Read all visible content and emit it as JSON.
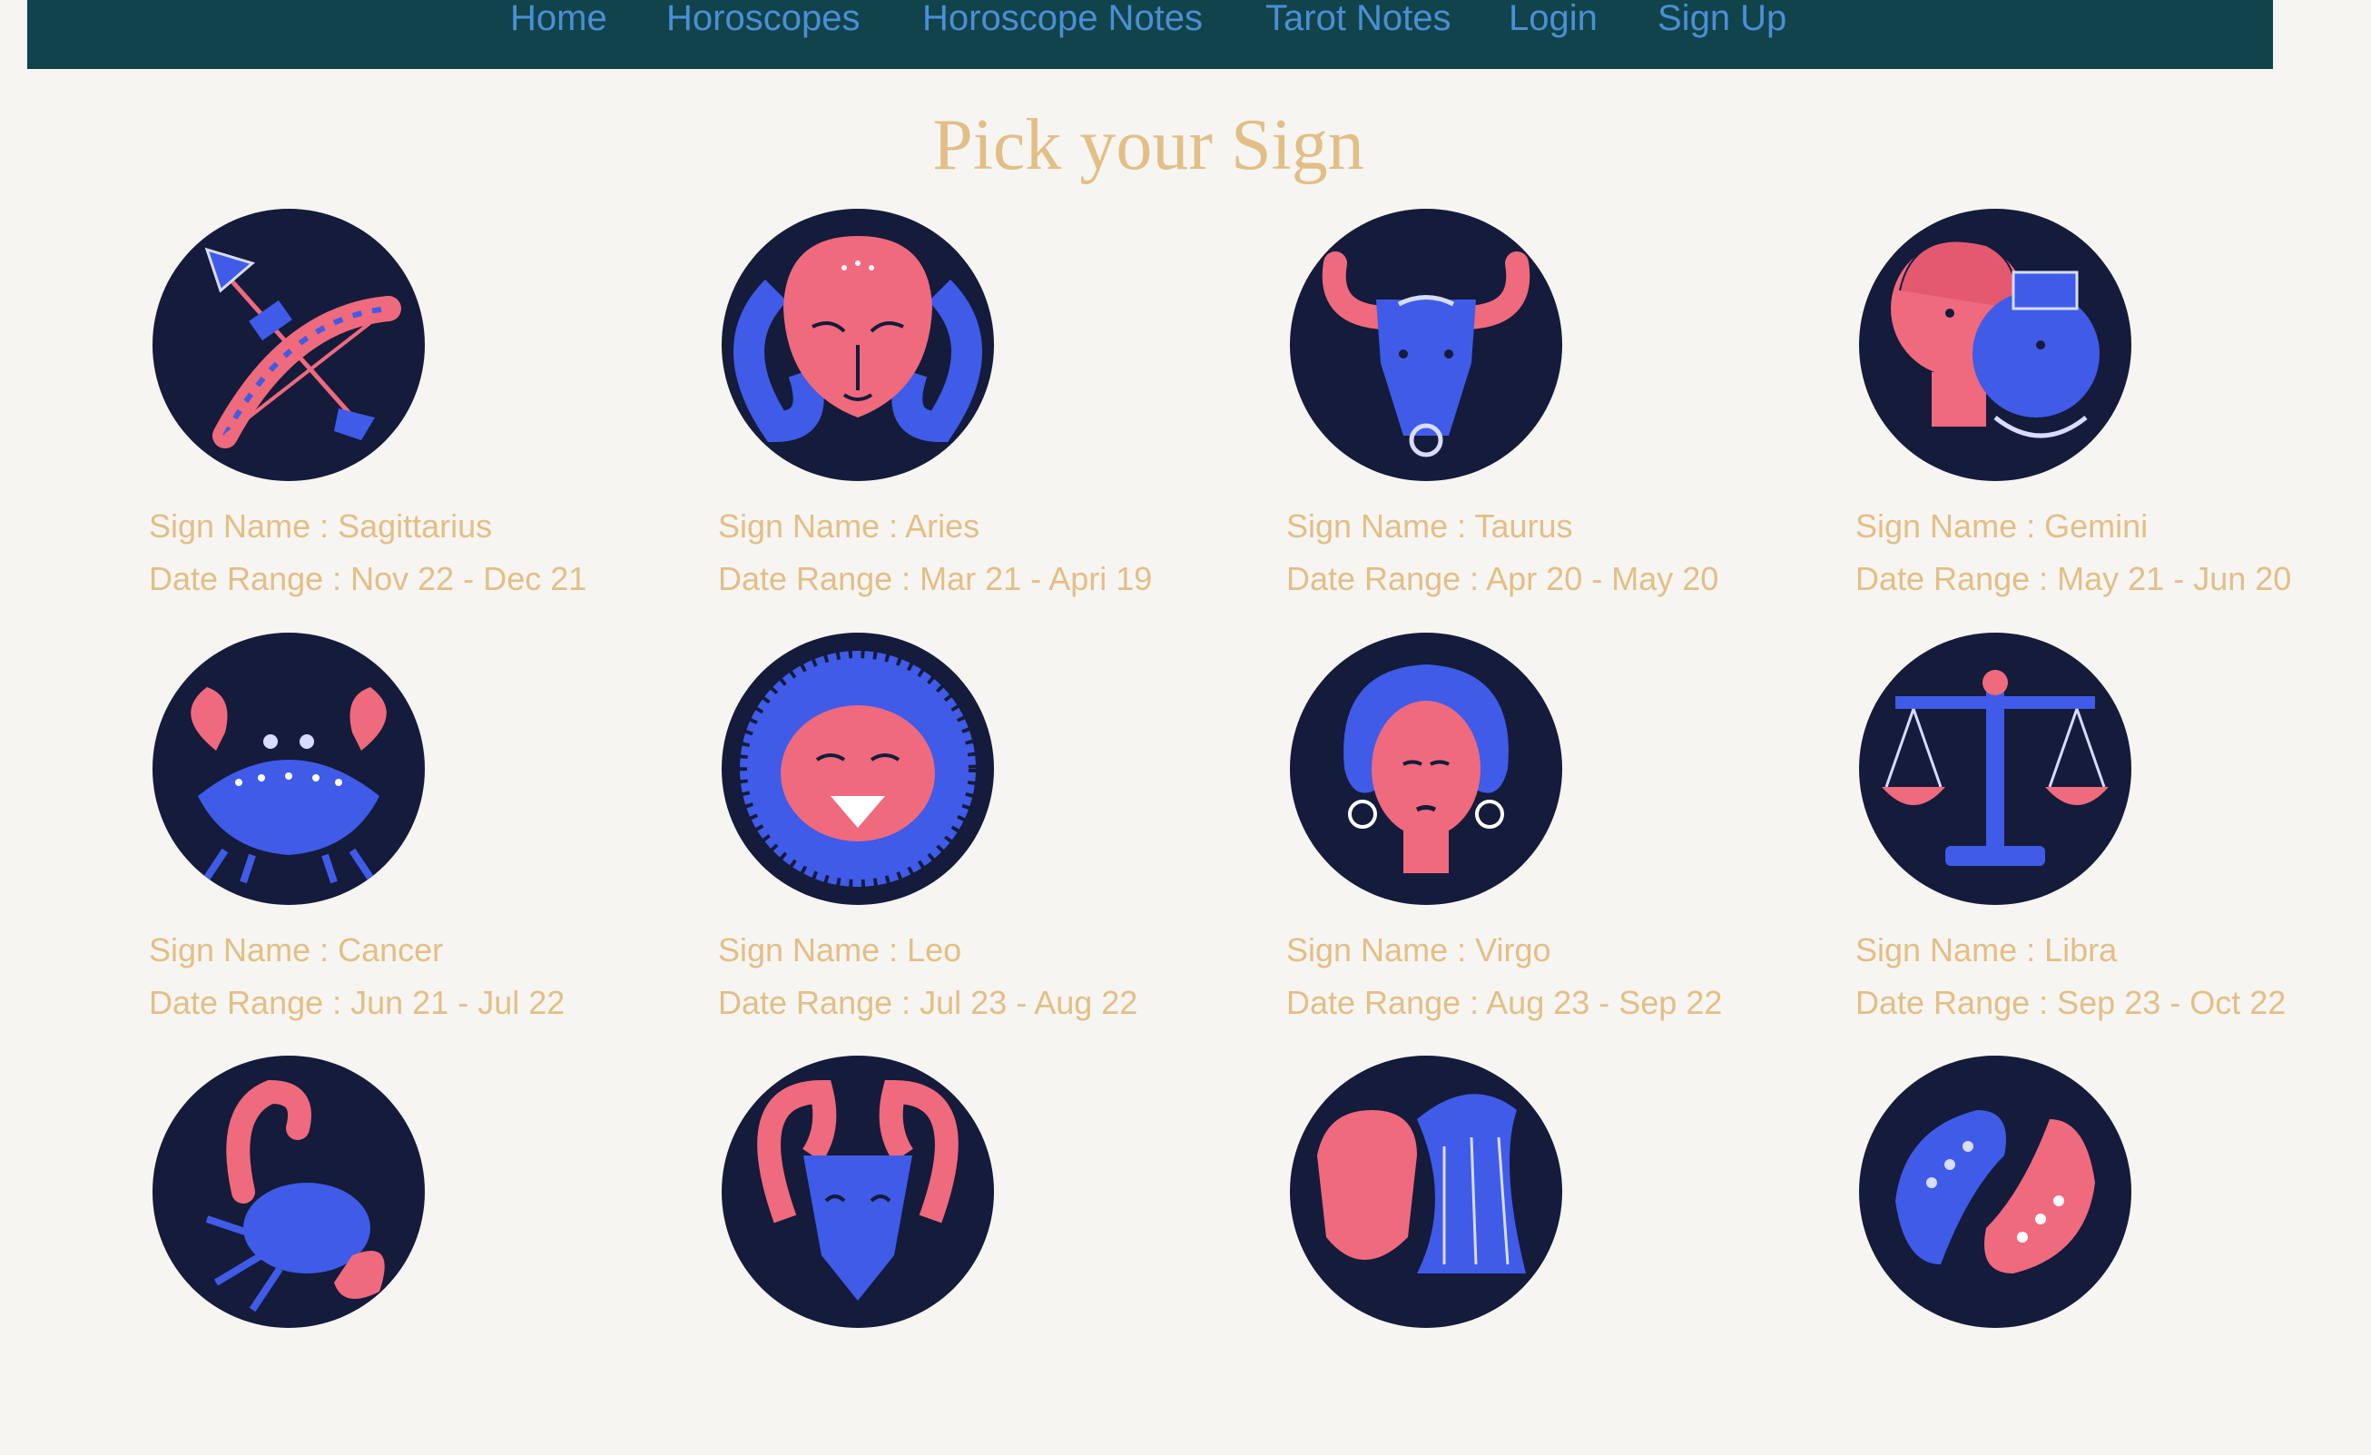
{
  "nav": {
    "links": [
      "Home",
      "Horoscopes",
      "Horoscope Notes",
      "Tarot Notes",
      "Login",
      "Sign Up"
    ]
  },
  "page": {
    "title": "Pick your Sign"
  },
  "labels": {
    "sign_prefix": "Sign Name : ",
    "date_prefix": "Date Range : "
  },
  "signs": [
    {
      "name": "Sagittarius",
      "range": "Nov 22 - Dec 21",
      "icon": "sagittarius-archer-icon"
    },
    {
      "name": "Aries",
      "range": "Mar 21 - Apri 19",
      "icon": "aries-ram-icon"
    },
    {
      "name": "Taurus",
      "range": "Apr 20 - May 20",
      "icon": "taurus-bull-icon"
    },
    {
      "name": "Gemini",
      "range": "May 21 - Jun 20",
      "icon": "gemini-twins-icon"
    },
    {
      "name": "Cancer",
      "range": "Jun 21 - Jul 22",
      "icon": "cancer-crab-icon"
    },
    {
      "name": "Leo",
      "range": "Jul 23 - Aug 22",
      "icon": "leo-lion-icon"
    },
    {
      "name": "Virgo",
      "range": "Aug 23 - Sep 22",
      "icon": "virgo-maiden-icon"
    },
    {
      "name": "Libra",
      "range": "Sep 23 - Oct 22",
      "icon": "libra-scales-icon"
    },
    {
      "name": "",
      "range": "",
      "icon": "scorpio-scorpion-icon"
    },
    {
      "name": "",
      "range": "",
      "icon": "capricorn-goat-icon"
    },
    {
      "name": "",
      "range": "",
      "icon": "aquarius-water-bearer-icon"
    },
    {
      "name": "",
      "range": "",
      "icon": "pisces-fish-icon"
    }
  ],
  "colors": {
    "navbar": "#11434a",
    "nav_link": "#4a8fd6",
    "accent_gold": "#e2bf87",
    "circle_bg": "#141b3b",
    "illustration_pink": "#ef6a7d",
    "illustration_blue": "#3f5be8",
    "page_bg": "#f7f5f1"
  }
}
